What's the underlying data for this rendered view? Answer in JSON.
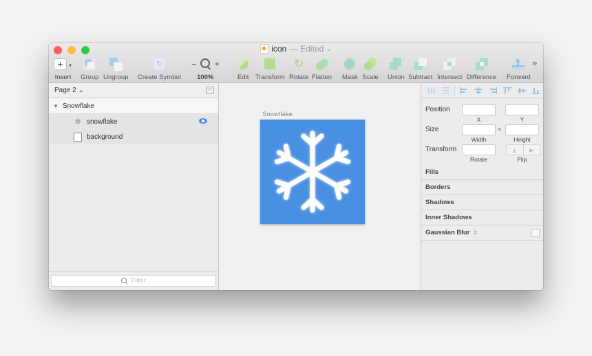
{
  "window": {
    "title": "icon",
    "title_separator": "—",
    "status": "Edited",
    "status_chevron": "⌄"
  },
  "traffic_lights": {
    "close": "#fc605b",
    "minimize": "#fdbc40",
    "zoom": "#34c84a"
  },
  "toolbar": {
    "insert": "Insert",
    "group": "Group",
    "ungroup": "Ungroup",
    "create_symbol": "Create Symbol",
    "zoom_minus": "−",
    "zoom_plus": "+",
    "zoom_level": "100%",
    "edit": "Edit",
    "transform": "Transform",
    "rotate": "Rotate",
    "flatten": "Flatten",
    "mask": "Mask",
    "scale": "Scale",
    "union": "Union",
    "subtract": "Subtract",
    "intersect": "Intersect",
    "difference": "Difference",
    "forward": "Forward",
    "overflow": "»"
  },
  "layers_panel": {
    "page_selector": "Page 2 ⌄",
    "group": {
      "name": "Snowflake",
      "expanded": true
    },
    "layers": [
      {
        "name": "snowflake",
        "icon": "snowflake-icon",
        "selected": true,
        "visible": true
      },
      {
        "name": "background",
        "icon": "rectangle-icon",
        "selected": false
      }
    ],
    "filter_placeholder": "Filter"
  },
  "canvas": {
    "artboard_label": "Snowflake",
    "artboard_color": "#4a90e2"
  },
  "inspector": {
    "position_label": "Position",
    "x_label": "X",
    "y_label": "Y",
    "x_value": "",
    "y_value": "",
    "size_label": "Size",
    "width_label": "Width",
    "height_label": "Height",
    "width_value": "",
    "height_value": "",
    "transform_label": "Transform",
    "rotate_label": "Rotate",
    "rotate_value": "",
    "flip_label": "Flip",
    "sections": [
      "Fills",
      "Borders",
      "Shadows",
      "Inner Shadows"
    ],
    "gaussian_blur": "Gaussian Blur",
    "gaussian_blur_stepper": "⌃⌄",
    "gaussian_blur_enabled": false
  },
  "accent_color": "#4a90e2"
}
